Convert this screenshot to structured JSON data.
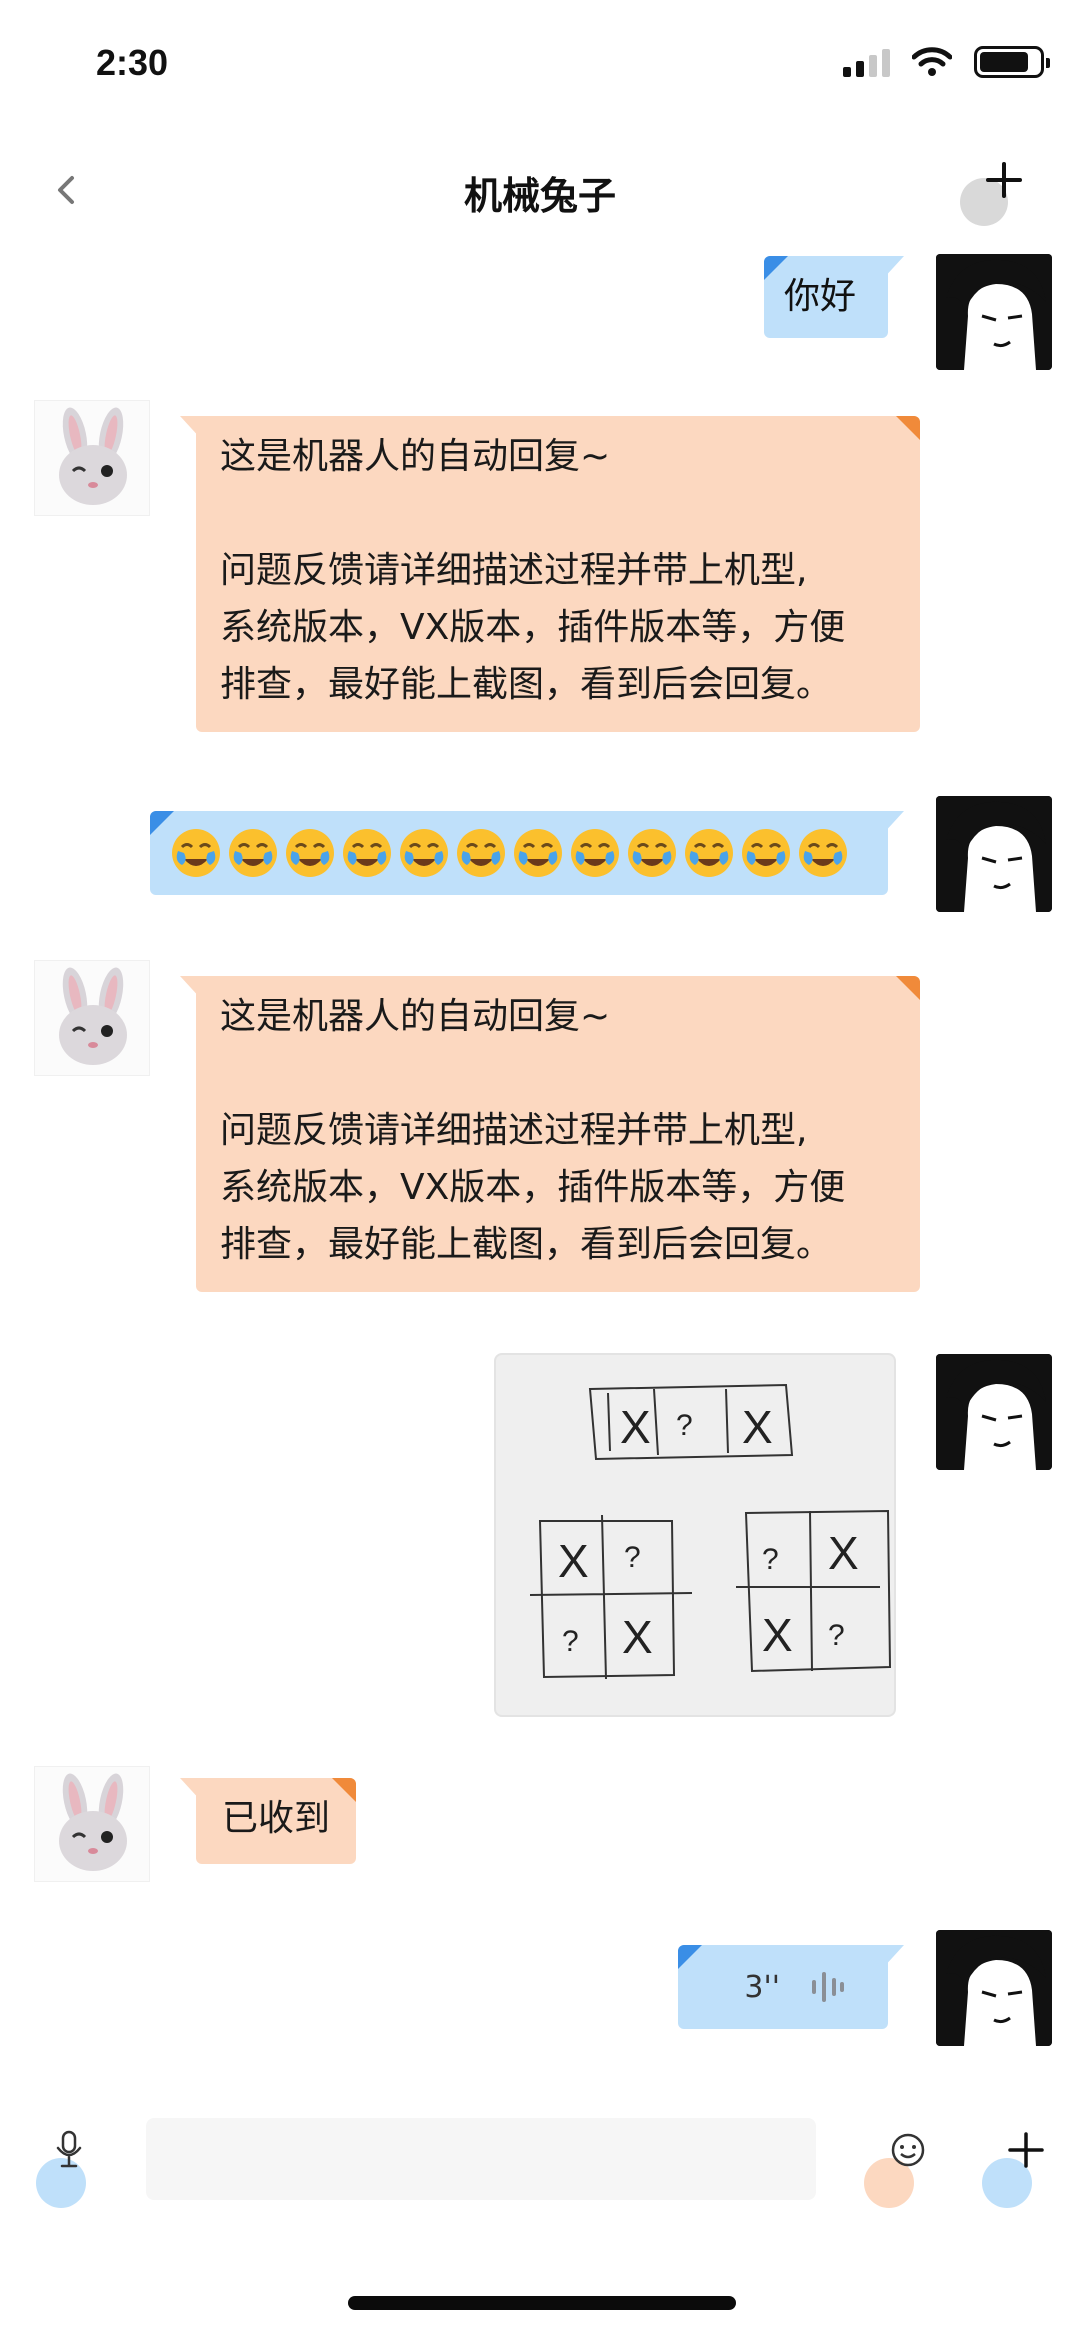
{
  "status_bar": {
    "time": "2:30"
  },
  "header": {
    "title": "机械兔子"
  },
  "messages": [
    {
      "sender": "me",
      "type": "text",
      "text": "你好"
    },
    {
      "sender": "bot",
      "type": "text",
      "text": "这是机器人的自动回复~\n\n问题反馈请详细描述过程并带上机型,\n系统版本，VX版本，插件版本等，方便\n排查，最好能上截图，看到后会回复。"
    },
    {
      "sender": "me",
      "type": "emoji",
      "emoji_name": "face-with-tears-icon",
      "count": 12
    },
    {
      "sender": "bot",
      "type": "text",
      "text": "这是机器人的自动回复~\n\n问题反馈请详细描述过程并带上机型,\n系统版本，VX版本，插件版本等，方便\n排查，最好能上截图，看到后会回复。"
    },
    {
      "sender": "me",
      "type": "image",
      "description_icon": "hand-drawn-grid-icon",
      "grid_marks": [
        "X",
        "?",
        "X",
        "X",
        "?",
        "?",
        "X",
        "?",
        "X",
        "X",
        "?"
      ]
    },
    {
      "sender": "bot",
      "type": "text",
      "text": "已收到"
    },
    {
      "sender": "me",
      "type": "voice",
      "duration": "3''"
    }
  ],
  "input_bar": {
    "placeholder": ""
  },
  "colors": {
    "my_bubble": "#bfe0fa",
    "bot_bubble": "#fcd8c0",
    "my_accent": "#3a8ee6",
    "bot_accent": "#f08a3a"
  }
}
